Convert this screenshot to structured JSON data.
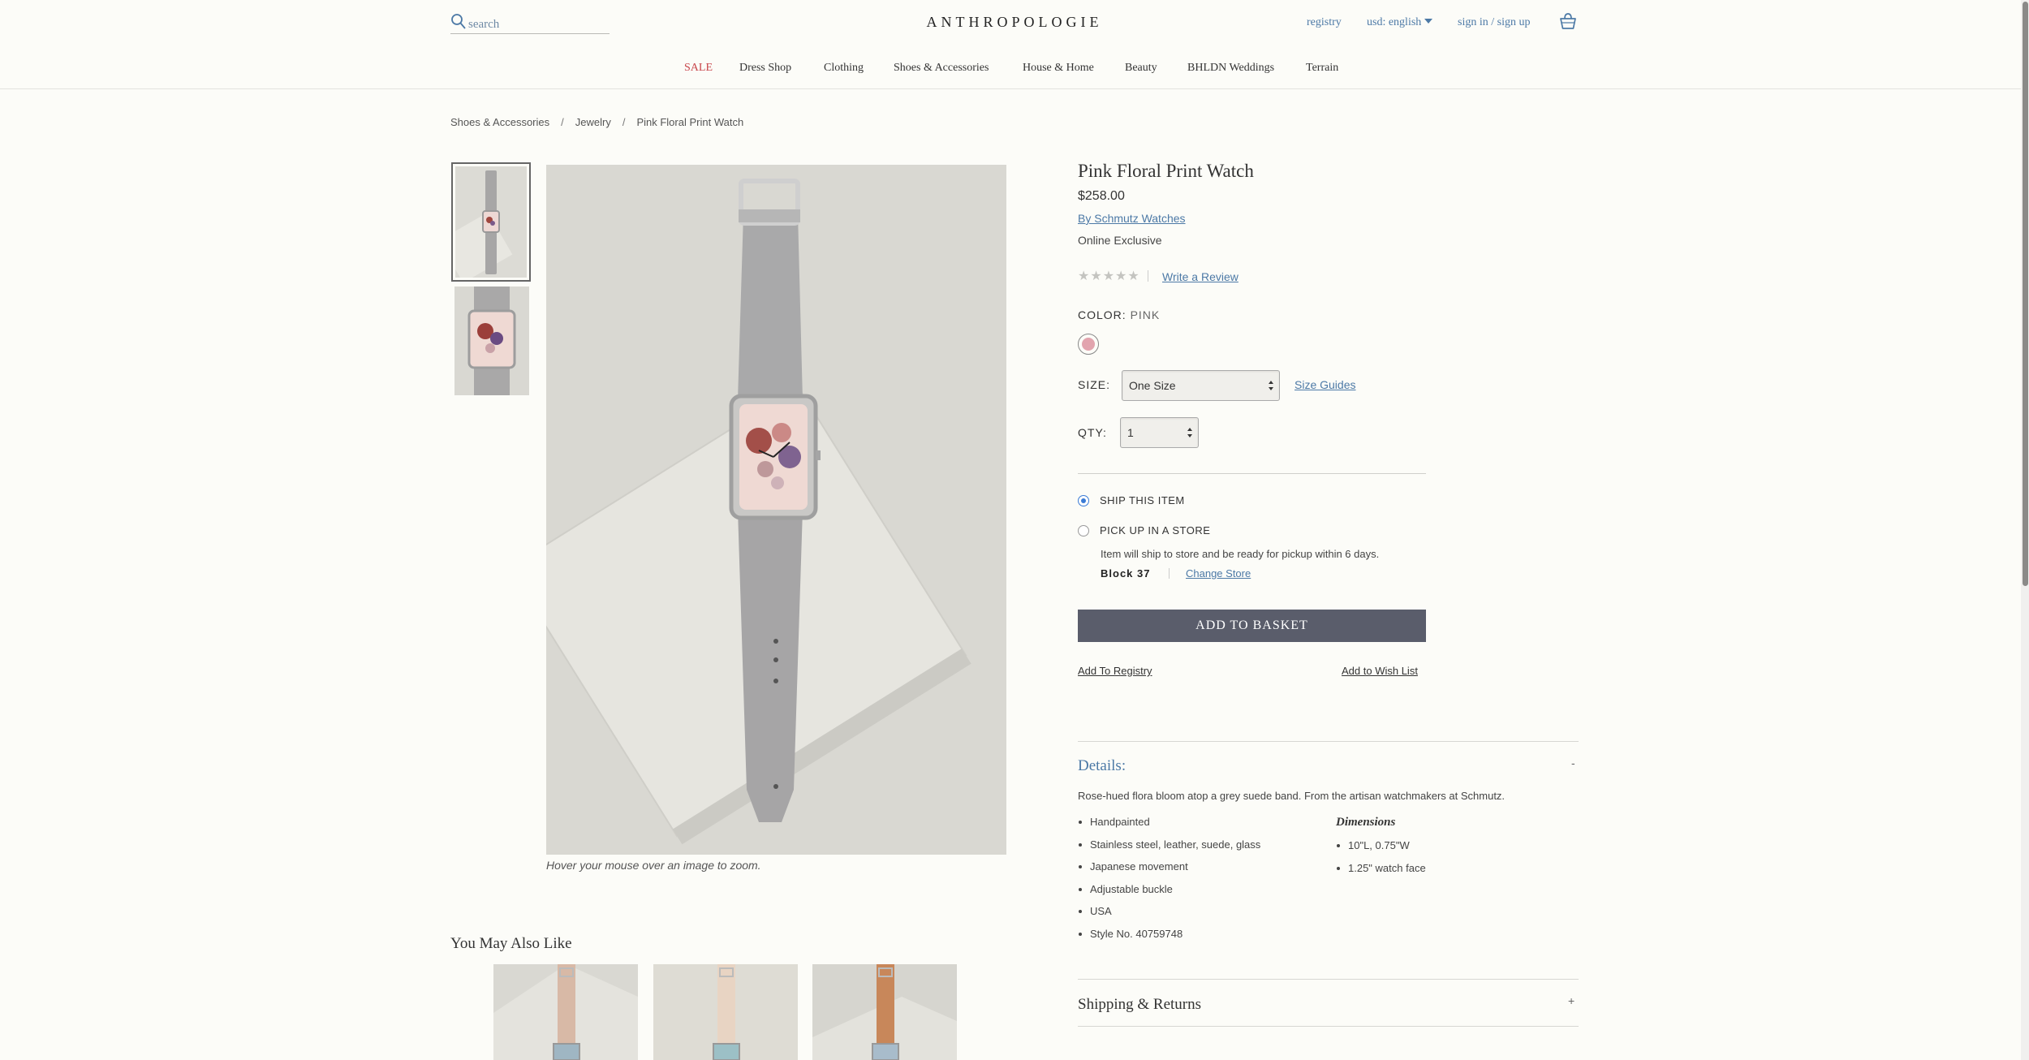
{
  "header": {
    "search_placeholder": "search",
    "logo": "ANTHROPOLOGIE",
    "registry": "registry",
    "language": "usd: english",
    "sign_in": "sign in / sign up",
    "accent_color": "#4c79a6"
  },
  "nav": {
    "items": [
      "SALE",
      "Dress Shop",
      "Clothing",
      "Shoes & Accessories",
      "House & Home",
      "Beauty",
      "BHLDN Weddings",
      "Terrain"
    ],
    "sale_color": "#c8464b"
  },
  "breadcrumb": [
    "Shoes & Accessories",
    "Jewelry",
    "Pink Floral Print Watch"
  ],
  "gallery": {
    "caption": "Hover your mouse over an image to zoom."
  },
  "product": {
    "title": "Pink Floral Print Watch",
    "price": "$258.00",
    "brand": "By Schmutz Watches",
    "exclusive": "Online Exclusive",
    "rating_stars": 0,
    "stars_glyphs": "★★★★★",
    "write_review": "Write a Review",
    "color_label": "COLOR:",
    "color_value": "PINK",
    "swatch_color": "#e2a4ae",
    "size_label": "SIZE:",
    "size_value": "One Size",
    "size_guides": "Size Guides",
    "qty_label": "QTY:",
    "qty_value": "1",
    "ship_option": "SHIP THIS ITEM",
    "pickup_option": "PICK UP IN A STORE",
    "pickup_note": "Item will ship to store and be ready for pickup within 6 days.",
    "store_name": "Block 37",
    "change_store": "Change Store",
    "add_to_basket": "ADD TO BASKET",
    "add_to_registry": "Add To Registry",
    "add_to_wishlist": "Add to Wish List"
  },
  "details": {
    "heading": "Details:",
    "toggle": "-",
    "description": "Rose-hued flora bloom atop a grey suede band. From the artisan watchmakers at Schmutz.",
    "bullets": [
      "Handpainted",
      "Stainless steel, leather, suede, glass",
      "Japanese movement",
      "Adjustable buckle",
      "USA",
      "Style No. 40759748"
    ],
    "dimensions_heading": "Dimensions",
    "dimensions": [
      "10\"L, 0.75\"W",
      "1.25\" watch face"
    ]
  },
  "shipping": {
    "heading": "Shipping & Returns",
    "toggle": "+"
  },
  "recommendations": {
    "heading": "You May Also Like"
  }
}
